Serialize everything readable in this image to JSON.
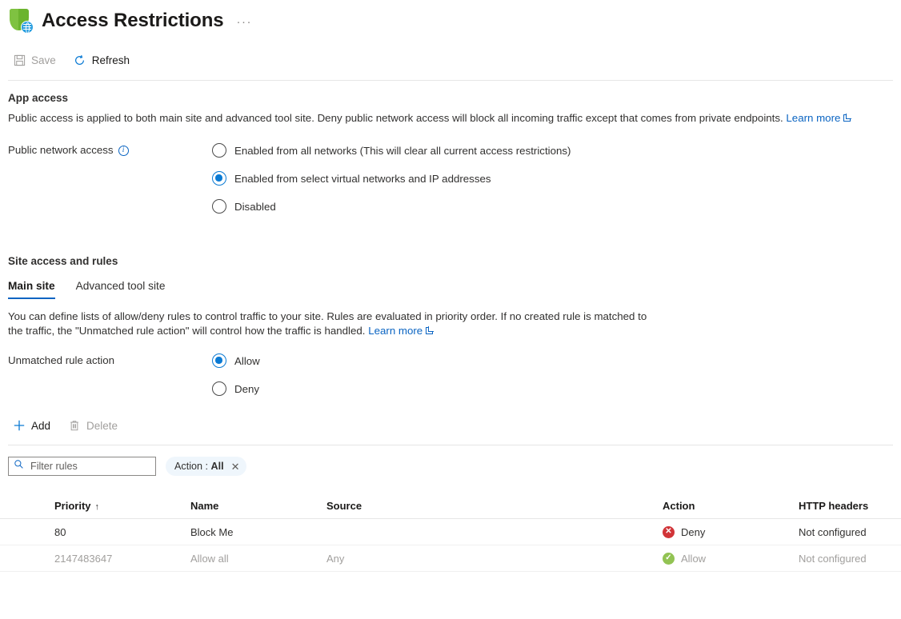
{
  "header": {
    "title": "Access Restrictions",
    "icon": "shield-globe-icon",
    "more_menu": "···"
  },
  "commandbar": {
    "save_label": "Save",
    "save_icon": "save-icon",
    "save_disabled": true,
    "refresh_label": "Refresh",
    "refresh_icon": "refresh-icon"
  },
  "app_access": {
    "section_title": "App access",
    "description": "Public access is applied to both main site and advanced tool site. Deny public network access will block all incoming traffic except that comes from private endpoints.",
    "learn_more": "Learn more",
    "field_label": "Public network access",
    "info_icon": "info-icon",
    "options": [
      {
        "label": "Enabled from all networks (This will clear all current access restrictions)",
        "selected": false
      },
      {
        "label": "Enabled from select virtual networks and IP addresses",
        "selected": true
      },
      {
        "label": "Disabled",
        "selected": false
      }
    ]
  },
  "site_access": {
    "section_title": "Site access and rules",
    "tabs": [
      {
        "label": "Main site",
        "active": true
      },
      {
        "label": "Advanced tool site",
        "active": false
      }
    ],
    "description": "You can define lists of allow/deny rules to control traffic to your site. Rules are evaluated in priority order. If no created rule is matched to the traffic, the \"Unmatched rule action\" will control how the traffic is handled.",
    "learn_more": "Learn more",
    "unmatched_label": "Unmatched rule action",
    "unmatched_options": [
      {
        "label": "Allow",
        "selected": true
      },
      {
        "label": "Deny",
        "selected": false
      }
    ]
  },
  "table_toolbar": {
    "add_label": "Add",
    "add_icon": "plus-icon",
    "delete_label": "Delete",
    "delete_icon": "trash-icon",
    "delete_disabled": true
  },
  "filters": {
    "search_placeholder": "Filter rules",
    "search_value": "",
    "search_icon": "search-icon",
    "pill_label": "Action :",
    "pill_value": "All",
    "pill_clear_icon": "close-icon"
  },
  "rules_table": {
    "columns": [
      {
        "key": "priority",
        "label": "Priority",
        "sort": "↑"
      },
      {
        "key": "name",
        "label": "Name"
      },
      {
        "key": "source",
        "label": "Source"
      },
      {
        "key": "action",
        "label": "Action"
      },
      {
        "key": "http_headers",
        "label": "HTTP headers"
      }
    ],
    "rows": [
      {
        "priority": "80",
        "name": "Block Me",
        "source": "",
        "action": "Deny",
        "action_status": "deny",
        "http_headers": "Not configured",
        "muted": false
      },
      {
        "priority": "2147483647",
        "name": "Allow all",
        "source": "Any",
        "action": "Allow",
        "action_status": "allow",
        "http_headers": "Not configured",
        "muted": true
      }
    ]
  },
  "colors": {
    "accent": "#0a64c2",
    "radio_selected": "#0a7ad4",
    "deny": "#d13438",
    "allow": "#92c353",
    "shield_green": "#6bb42e",
    "globe_blue": "#2a9fe0"
  }
}
